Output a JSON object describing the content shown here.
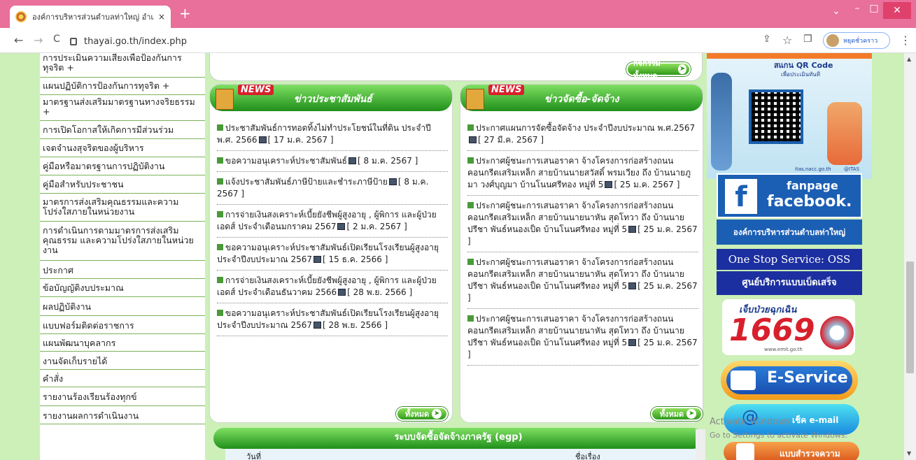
{
  "browser": {
    "tab_title": "องค์การบริหารส่วนตำบลท่าใหญ่ อำเภ",
    "tab_close": "×",
    "new_tab": "+",
    "url": "thayai.go.th/index.php",
    "profile_label": "หยุดชั่วคราว",
    "back": "←",
    "forward": "→",
    "reload": "C",
    "share": "⇪",
    "star": "☆",
    "sidepanel": "❐",
    "menu": "⋮",
    "chevron": "⌄",
    "minimize": "–",
    "maximize": "□",
    "close": "✕"
  },
  "sidebar": {
    "items": [
      "การประเมินความเสี่ยงเพื่อป้องกันการทุจริต +",
      "แผนปฏิบัติการป้องกันการทุจริต +",
      "มาตรฐานส่งเสริมมาตรฐานทางจริยธรรม +",
      "การเปิดโอกาสให้เกิดการมีส่วนร่วม",
      "เจตจำนงสุจริตของผู้บริหาร",
      "คู่มือหรือมาตรฐานการปฏิบัติงาน",
      "คู่มือสำหรับประชาชน",
      "มาตรการส่งเสริมคุณธรรมและความโปร่งใสภายในหน่วยงาน",
      "การดำเนินการตามมาตรการส่งเสริมคุณธรรม และความโปร่งใสภายในหน่วยงาน",
      "ประกาศ",
      "ข้อบัญญัติงบประมาณ",
      "ผลปฏิบัติงาน",
      "แบบฟอร์มติดต่อราชการ",
      "แผนพัฒนาบุคลากร",
      "งานจัดเก็บรายได้",
      "คำสั่ง",
      "รายงานร้องเรียนร้องทุกข์",
      "รายงานผลการดำเนินงาน"
    ]
  },
  "activities": {
    "all_label": "กิจกรรมทั้งหมด"
  },
  "pr_news": {
    "badge": "NEWS",
    "title": "ข่าวประชาสัมพันธ์",
    "all_label": "ทั้งหมด",
    "items": [
      {
        "text": "ประชาสัมพันธ์การทอดทิ้งไม่ทำประโยชน์ในที่ดิน ประจำปี พ.ศ. 2566",
        "date": "[ 17 ม.ค. 2567 ]"
      },
      {
        "text": "ขอความอนุเคราะห์ประชาสัมพันธ์",
        "date": "[ 8 ม.ค. 2567 ]"
      },
      {
        "text": "แจ้งประชาสัมพันธ์ภาษีป้ายและชำระภาษีป้าย",
        "date": "[ 8 ม.ค. 2567 ]"
      },
      {
        "text": "การจ่ายเงินสงเคราะห์เบี้ยยังชีพผู้สูงอายุ , ผู้พิการ และผู้ป่วยเอดส์ ประจำเดือนมกราคม 2567",
        "date": "[ 2 ม.ค. 2567 ]"
      },
      {
        "text": "ขอความอนุเคราะห์ประชาสัมพันธ์เปิดเรียนโรงเรียนผู้สูงอายุ ประจำปีงบประมาณ 2567",
        "date": "[ 15 ธ.ค. 2566 ]"
      },
      {
        "text": "การจ่ายเงินสงเคราะห์เบี้ยยังชีพผู้สูงอายุ , ผู้พิการ และผู้ป่วยเอดส์ ประจำเดือนธันวาคม 2566",
        "date": "[ 28 พ.ย. 2566 ]"
      },
      {
        "text": "ขอความอนุเคราะห์ประชาสัมพันธ์เปิดเรียนโรงเรียนผู้สูงอายุ ประจำปีงบประมาณ 2567",
        "date": "[ 28 พ.ย. 2566 ]"
      }
    ]
  },
  "procurement": {
    "badge": "NEWS",
    "title": "ข่าวจัดซื้อ-จัดจ้าง",
    "all_label": "ทั้งหมด",
    "items": [
      {
        "text": "ประกาศแผนการจัดซื้อจัดจ้าง ประจำปีงบประมาณ พ.ศ.2567",
        "date": "[ 27 มี.ค. 2567 ]"
      },
      {
        "text": "ประกาศผู้ชนะการเสนอราคา จ้างโครงการก่อสร้างถนนคอนกรีตเสริมเหล็ก สายบ้านนายสวัสดิ์ พรมเวียง ถึง บ้านนายภูมา วงศ์บุญมา บ้านโนนศรีทอง หมู่ที่ 5",
        "date": "[ 25 ม.ค. 2567 ]"
      },
      {
        "text": "ประกาศผู้ชนะการเสนอราคา จ้างโครงการก่อสร้างถนนคอนกรีตเสริมเหล็ก สายบ้านนายนาหัน สุดโทวา ถึง บ้านนายปรีชา พันธ์หนองเป็ด บ้านโนนศรีทอง หมู่ที่ 5",
        "date": "[ 25 ม.ค. 2567 ]"
      },
      {
        "text": "ประกาศผู้ชนะการเสนอราคา จ้างโครงการก่อสร้างถนนคอนกรีตเสริมเหล็ก สายบ้านนายนาหัน สุดโทวา ถึง บ้านนายปรีชา พันธ์หนองเป็ด บ้านโนนศรีทอง หมู่ที่ 5",
        "date": "[ 25 ม.ค. 2567 ]"
      },
      {
        "text": "ประกาศผู้ชนะการเสนอราคา จ้างโครงการก่อสร้างถนนคอนกรีตเสริมเหล็ก สายบ้านนายนาหัน สุดโทวา ถึง บ้านนายปรีชา พันธ์หนองเป็ด บ้านโนนศรีทอง หมู่ที่ 5",
        "date": "[ 25 ม.ค. 2567 ]"
      }
    ]
  },
  "egp": {
    "title": "ระบบจัดซื้อจัดจ้างภาครัฐ (egp)",
    "col_date": "วันที่",
    "col_subject": "ชื่อเรื่อง"
  },
  "right": {
    "qr_scan": "สแกน QR Code",
    "qr_sub": "เพื่อประเมินทันที",
    "itas_url": "itas.nacc.go.th",
    "itas_tag": "@ITAS",
    "fanpage": "fanpage",
    "facebook": "facebook.",
    "org_name": "องค์การบริหารส่วนตำบลท่าใหญ่",
    "oss": "One Stop Service: OSS",
    "oss_sub": "ศูนย์บริการแบบเบ็ดเสร็จ",
    "emergency": "เจ็บป่วยฉุกเฉิน",
    "emergency_num": "1669",
    "emergency_url": "www.emit.go.th",
    "eservice": "E-Service",
    "email": "เช็ค e-mail",
    "survey": "แบบสำรวจความ"
  },
  "watermark": {
    "line1": "Activate Windows",
    "line2": "Go to Settings to activate Windows."
  }
}
